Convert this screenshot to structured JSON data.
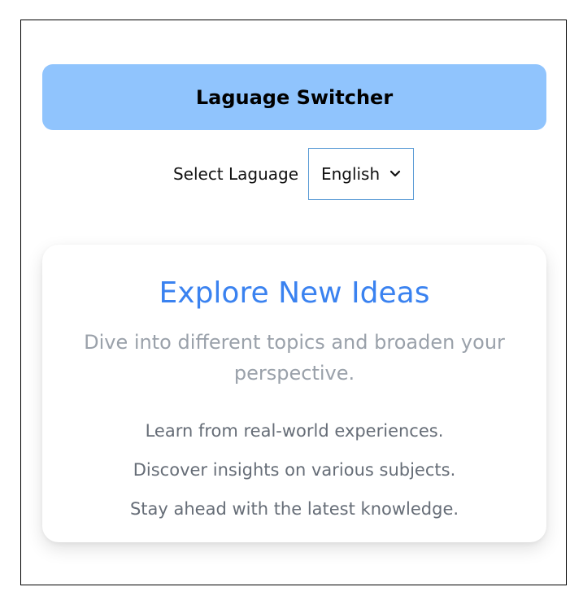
{
  "header": {
    "title": "Laguage Switcher"
  },
  "language": {
    "label": "Select Laguage",
    "selected": "English",
    "icon": "chevron-down-icon"
  },
  "card": {
    "title": "Explore New Ideas",
    "subtitle": "Dive into different topics and broaden your perspective.",
    "items": [
      "Learn from real-world experiences.",
      "Discover insights on various subjects.",
      "Stay ahead with the latest knowledge."
    ]
  },
  "colors": {
    "header_bg": "#90c4fd",
    "title_accent": "#3a82f0",
    "select_border": "#5a9bd5"
  }
}
